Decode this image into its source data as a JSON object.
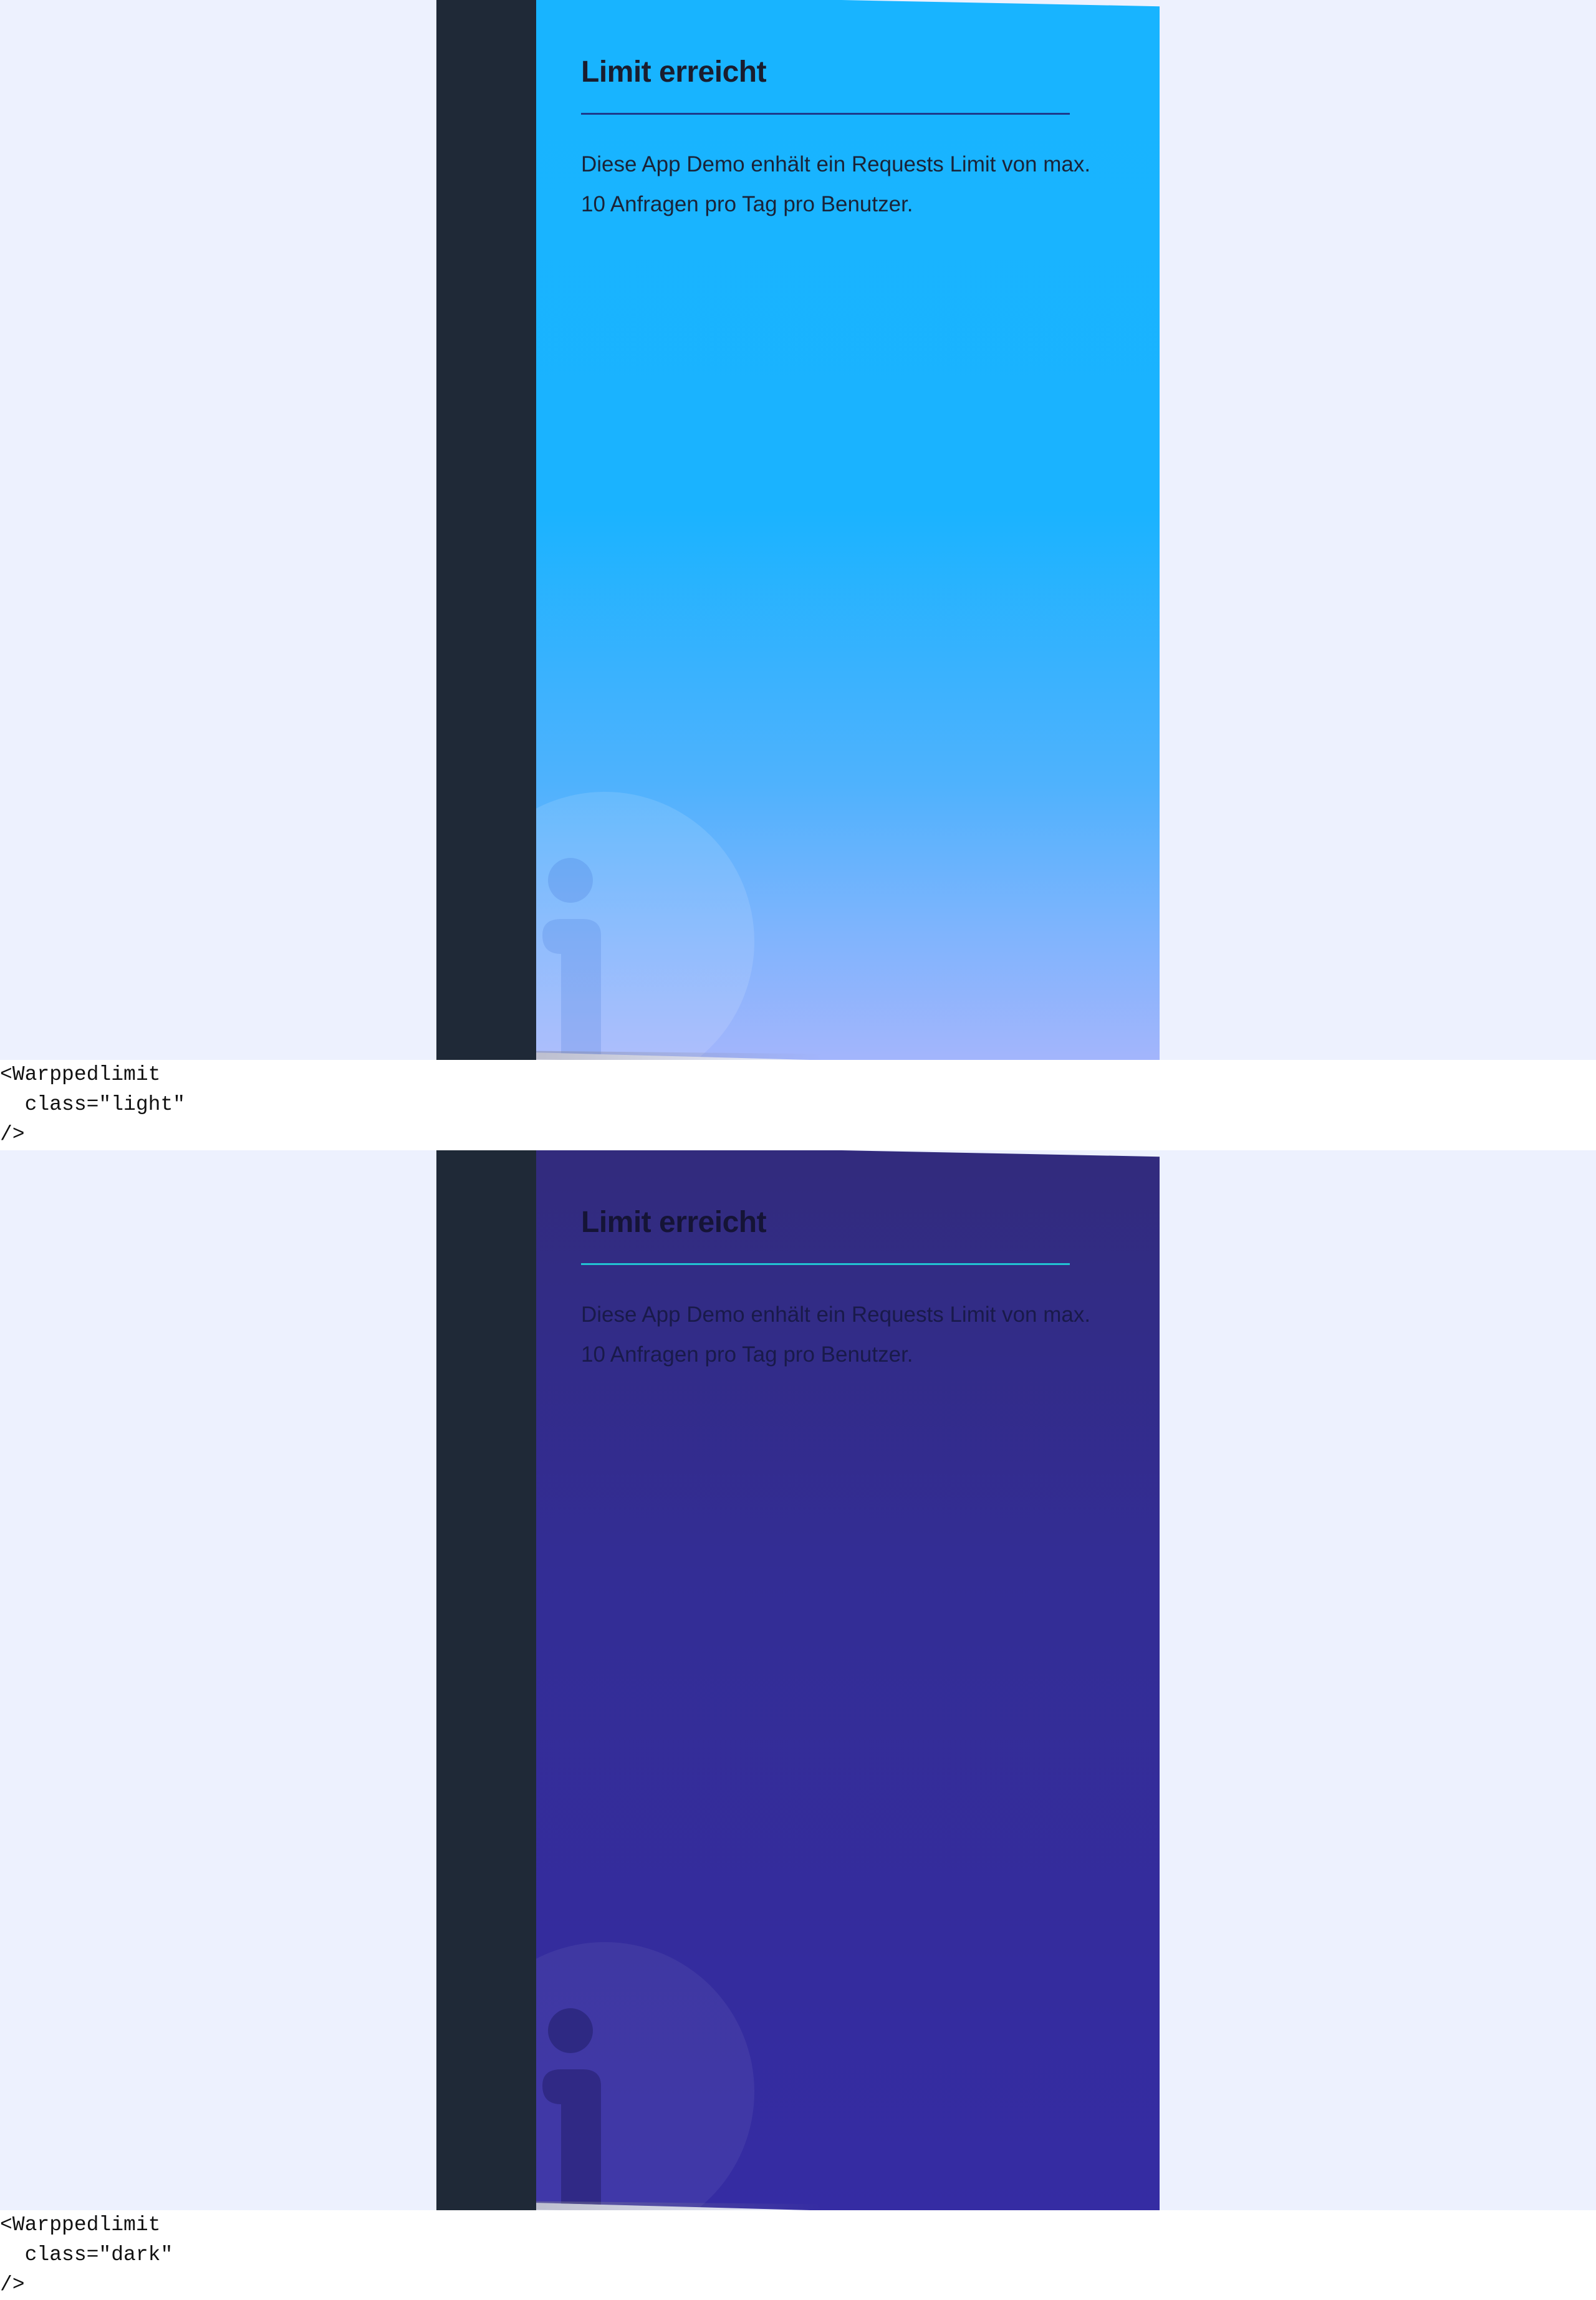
{
  "light": {
    "title": "Limit erreicht",
    "text": "Diese App Demo enhält ein Requests Limit von max. 10 Anfragen pro Tag pro Benutzer.",
    "code": "<Warppedlimit\n  class=\"light\"\n/>",
    "icon": "info-icon",
    "colors": {
      "background": "#edf1fe",
      "sidebar": "#1f2937",
      "card_top": "#18b4ff",
      "card_bottom": "#a3b5fc",
      "divider": "#1e3a8a"
    }
  },
  "dark": {
    "title": "Limit erreicht",
    "text": "Diese App Demo enhält ein Requests Limit von max. 10 Anfragen pro Tag pro Benutzer.",
    "code": "<Warppedlimit\n  class=\"dark\"\n/>",
    "icon": "info-icon",
    "colors": {
      "background": "#edf1fe",
      "sidebar": "#1f2937",
      "card_top": "#322b7d",
      "card_bottom": "#352ca3",
      "divider": "#22c3d3"
    }
  }
}
